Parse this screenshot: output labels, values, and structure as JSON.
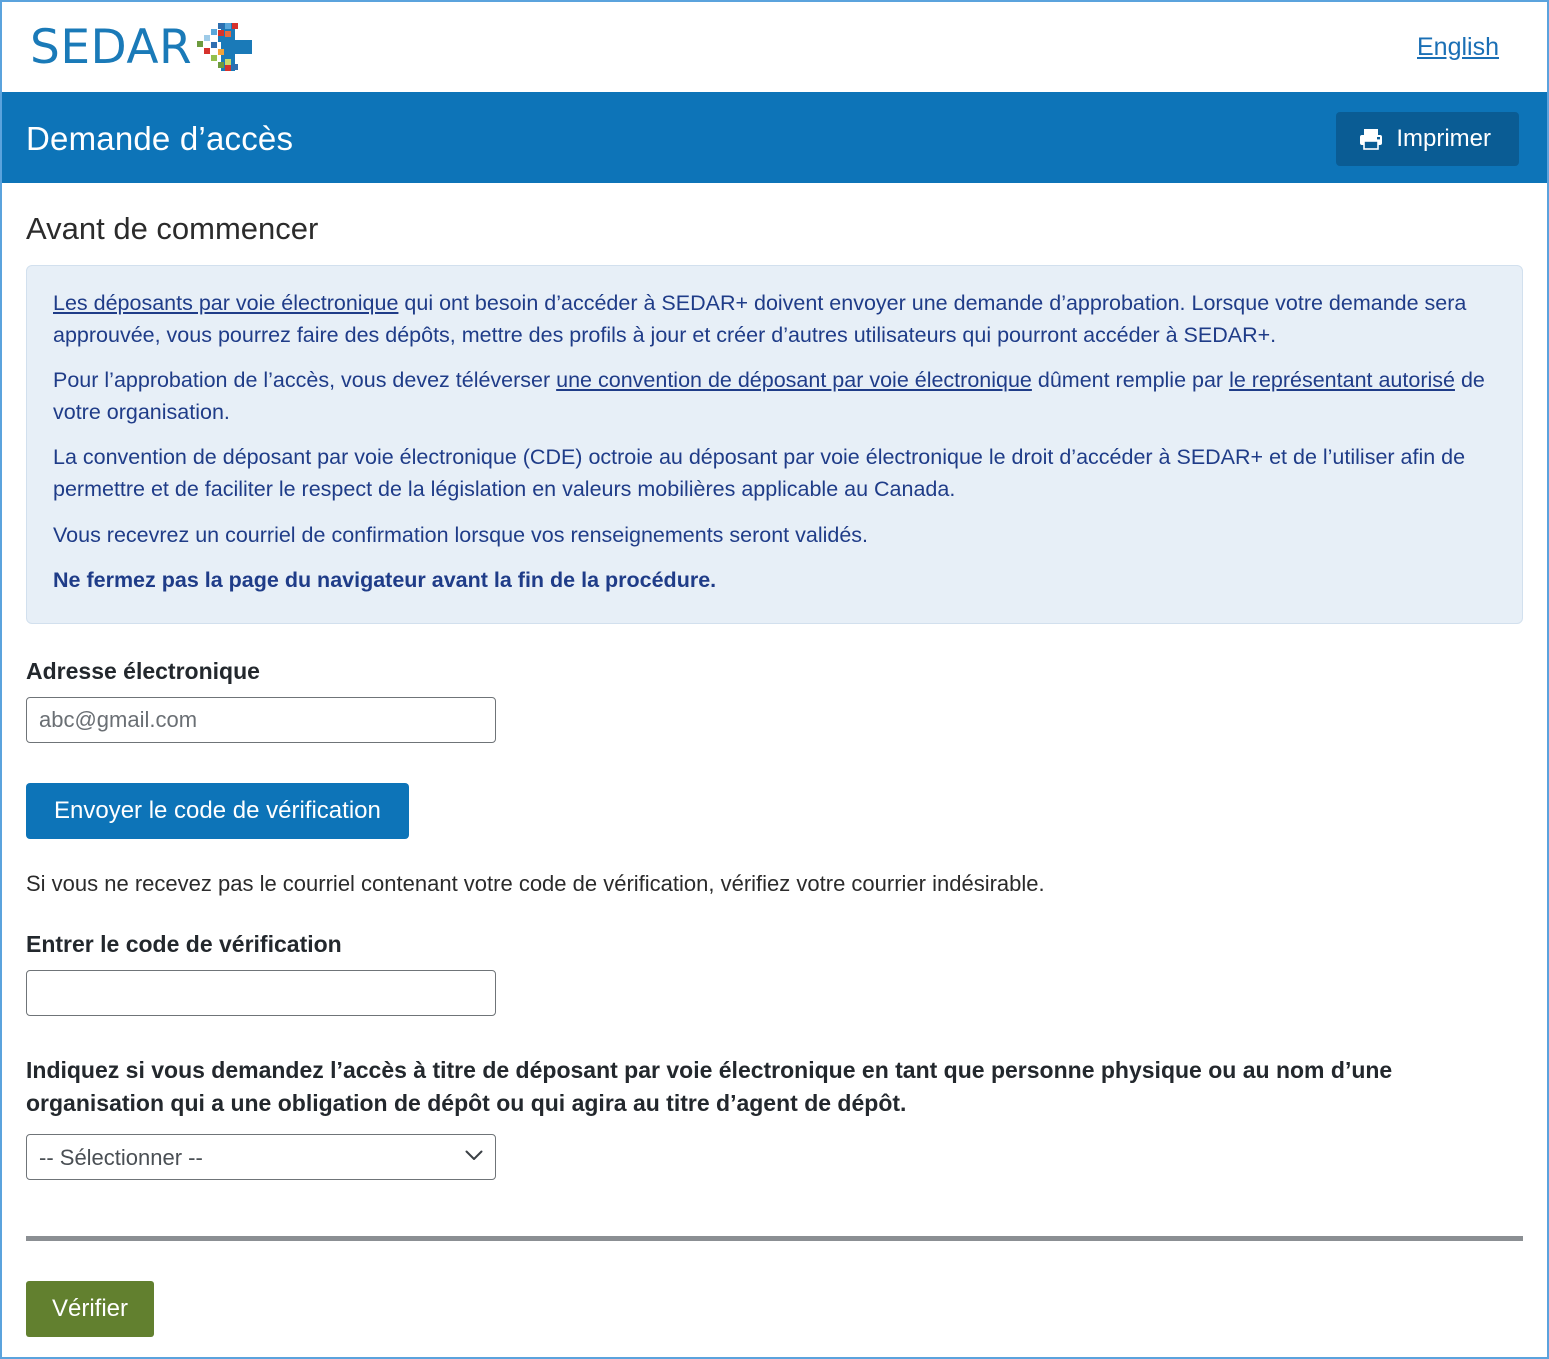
{
  "brand": {
    "wordmark": "SEDAR",
    "mark_name": "sedar-plus-mosaic-mark",
    "mark_colors": [
      "#1a7ab8",
      "#2f6fb0",
      "#5aa7db",
      "#9ecbe8",
      "#d6322c",
      "#e8693f",
      "#f0a33a",
      "#6d9b3e",
      "#94c04c",
      "#c9d96a"
    ]
  },
  "topbar": {
    "language_link": "English"
  },
  "header": {
    "title": "Demande d’accès",
    "print_label": "Imprimer",
    "print_icon": "printer-icon",
    "background_color": "#0d74b8"
  },
  "main": {
    "section_title": "Avant de commencer",
    "info_panel": {
      "background_color": "#e7eff7",
      "text_color": "#1f3c88",
      "paragraphs": [
        {
          "parts": [
            {
              "type": "link",
              "text": "Les déposants par voie électronique"
            },
            {
              "type": "text",
              "text": " qui ont besoin d’accéder à SEDAR+ doivent envoyer une demande d’approbation. Lorsque votre demande sera approuvée, vous pourrez faire des dépôts, mettre des profils à jour et créer d’autres utilisateurs qui pourront accéder à SEDAR+."
            }
          ]
        },
        {
          "parts": [
            {
              "type": "text",
              "text": "Pour l’approbation de l’accès, vous devez téléverser "
            },
            {
              "type": "link",
              "text": "une convention de déposant par voie électronique"
            },
            {
              "type": "text",
              "text": " dûment remplie par "
            },
            {
              "type": "link",
              "text": "le représentant autorisé"
            },
            {
              "type": "text",
              "text": " de votre organisation."
            }
          ]
        },
        {
          "parts": [
            {
              "type": "text",
              "text": "La convention de déposant par voie électronique (CDE) octroie au déposant par voie électronique le droit d’accéder à SEDAR+ et de l’utiliser afin de permettre et de faciliter le respect de la législation en valeurs mobilières applicable au Canada."
            }
          ]
        },
        {
          "parts": [
            {
              "type": "text",
              "text": "Vous recevrez un courriel de confirmation lorsque vos renseignements seront validés."
            }
          ]
        },
        {
          "parts": [
            {
              "type": "bold",
              "text": "Ne fermez pas la page du navigateur avant la fin de la procédure."
            }
          ]
        }
      ]
    },
    "email_field": {
      "label": "Adresse électronique",
      "placeholder": "abc@gmail.com",
      "value": ""
    },
    "send_code_button": {
      "label": "Envoyer le code de vérification",
      "color": "#0d74b8"
    },
    "helper_text": "Si vous ne recevez pas le courriel contenant votre code de vérification, vérifiez votre courrier indésirable.",
    "code_field": {
      "label": "Entrer le code de vérification",
      "placeholder": "",
      "value": ""
    },
    "filer_prompt": "Indiquez si vous demandez l’accès à titre de déposant par voie électronique en tant que personne physique ou au nom d’une organisation qui a une obligation de dépôt ou qui agira au titre d’agent de dépôt.",
    "filer_select": {
      "selected": "-- Sélectionner --",
      "options": [
        "-- Sélectionner --"
      ],
      "chevron_icon": "chevron-down-icon"
    },
    "submit_button": {
      "label": "Vérifier",
      "color": "#62802f"
    }
  }
}
